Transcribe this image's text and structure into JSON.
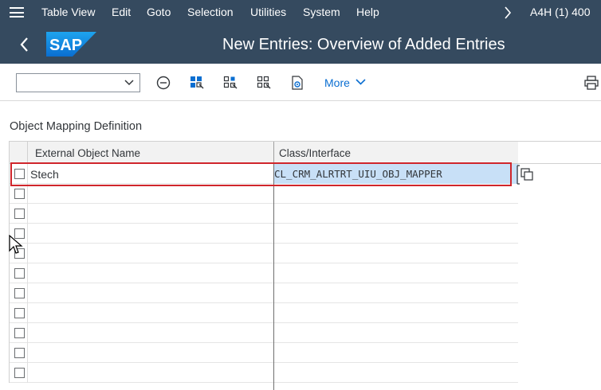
{
  "menu": {
    "items": [
      "Table View",
      "Edit",
      "Goto",
      "Selection",
      "Utilities",
      "System",
      "Help"
    ],
    "system_info": "A4H (1) 400"
  },
  "header": {
    "logo_text": "SAP",
    "title": "New Entries: Overview of Added Entries"
  },
  "toolbar": {
    "combo_value": "",
    "more_label": "More",
    "icons": [
      "minus-circle-icon",
      "select-all-icon",
      "deselect-all-icon",
      "select-block-icon",
      "settings-doc-icon",
      "print-icon"
    ]
  },
  "section": {
    "title": "Object Mapping Definition"
  },
  "table": {
    "columns": [
      "External Object Name",
      "Class/Interface"
    ],
    "rows": [
      {
        "external_object_name": "Stech",
        "class_interface": "CL_CRM_ALRTRT_UIU_OBJ_MAPPER"
      },
      {
        "external_object_name": "",
        "class_interface": ""
      },
      {
        "external_object_name": "",
        "class_interface": ""
      },
      {
        "external_object_name": "",
        "class_interface": ""
      },
      {
        "external_object_name": "",
        "class_interface": ""
      },
      {
        "external_object_name": "",
        "class_interface": ""
      },
      {
        "external_object_name": "",
        "class_interface": ""
      },
      {
        "external_object_name": "",
        "class_interface": ""
      },
      {
        "external_object_name": "",
        "class_interface": ""
      },
      {
        "external_object_name": "",
        "class_interface": ""
      },
      {
        "external_object_name": "",
        "class_interface": ""
      }
    ]
  },
  "colors": {
    "shell": "#354a5f",
    "accent": "#0a6ed1",
    "selected_cell": "#c8e0f7",
    "highlight_border": "#d0262c"
  }
}
